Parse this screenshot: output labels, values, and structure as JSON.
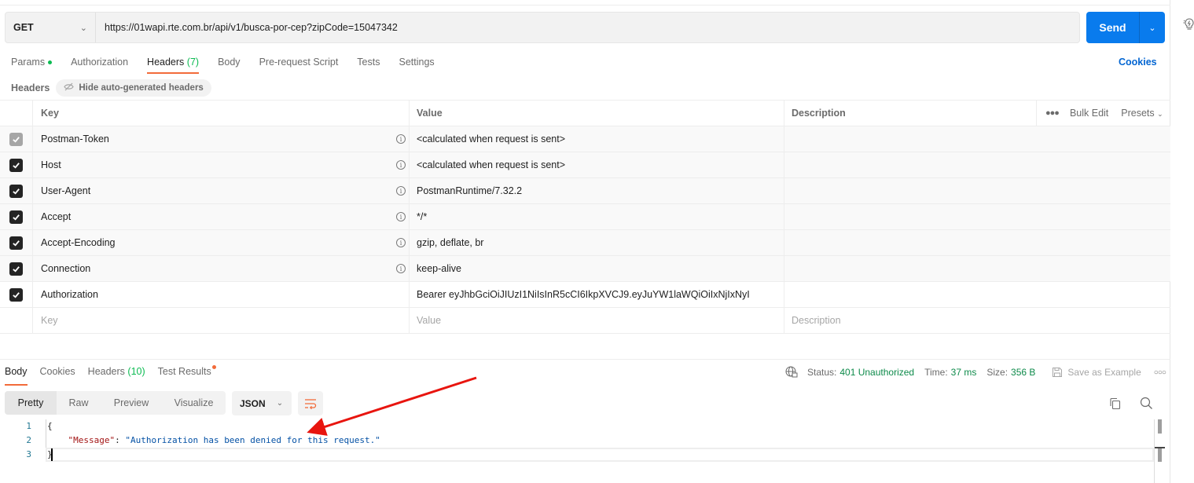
{
  "request": {
    "method": "GET",
    "url": "https://01wapi.rte.com.br/api/v1/busca-por-cep?zipCode=15047342",
    "send_label": "Send"
  },
  "request_tabs": [
    {
      "label": "Params",
      "has_dot": true
    },
    {
      "label": "Authorization"
    },
    {
      "label": "Headers",
      "count": "(7)",
      "active": true
    },
    {
      "label": "Body"
    },
    {
      "label": "Pre-request Script"
    },
    {
      "label": "Tests"
    },
    {
      "label": "Settings"
    }
  ],
  "cookies_label": "Cookies",
  "headers_section": {
    "title": "Headers",
    "hide_auto_label": "Hide auto-generated headers"
  },
  "table": {
    "columns": {
      "key": "Key",
      "value": "Value",
      "description": "Description"
    },
    "actions": {
      "bulk_edit": "Bulk Edit",
      "presets": "Presets"
    },
    "rows": [
      {
        "key": "Postman-Token",
        "value": "<calculated when request is sent>",
        "checked": true,
        "disabled": true,
        "auto": true
      },
      {
        "key": "Host",
        "value": "<calculated when request is sent>",
        "checked": true,
        "auto": true
      },
      {
        "key": "User-Agent",
        "value": "PostmanRuntime/7.32.2",
        "checked": true,
        "auto": true
      },
      {
        "key": "Accept",
        "value": "*/*",
        "checked": true,
        "auto": true
      },
      {
        "key": "Accept-Encoding",
        "value": "gzip, deflate, br",
        "checked": true,
        "auto": true
      },
      {
        "key": "Connection",
        "value": "keep-alive",
        "checked": true,
        "auto": true
      },
      {
        "key": "Authorization",
        "value": "Bearer eyJhbGciOiJIUzI1NiIsInR5cCI6IkpXVCJ9.eyJuYW1laWQiOiIxNjIxNyI",
        "checked": true,
        "auto": false
      }
    ],
    "new_row": {
      "key_placeholder": "Key",
      "value_placeholder": "Value",
      "description_placeholder": "Description"
    }
  },
  "response_tabs": [
    {
      "label": "Body",
      "active": true
    },
    {
      "label": "Cookies"
    },
    {
      "label": "Headers",
      "count": "(10)"
    },
    {
      "label": "Test Results",
      "has_dot": true
    }
  ],
  "response_status": {
    "status_label": "Status:",
    "status_value": "401 Unauthorized",
    "time_label": "Time:",
    "time_value": "37 ms",
    "size_label": "Size:",
    "size_value": "356 B",
    "save_example": "Save as Example"
  },
  "view_modes": [
    "Pretty",
    "Raw",
    "Preview",
    "Visualize"
  ],
  "active_view": "Pretty",
  "format": "JSON",
  "code": {
    "line_numbers": [
      "1",
      "2",
      "3"
    ],
    "open_brace": "{",
    "key": "\"Message\"",
    "colon": ": ",
    "value": "\"Authorization has been denied for this request.\"",
    "close_brace": "}"
  },
  "annotation": {
    "color": "#e8150f"
  },
  "colors": {
    "accent": "#097bed",
    "active_tab": "#f26b3a",
    "status_ok": "#0d8a4a",
    "count_green": "#0cbb52"
  }
}
